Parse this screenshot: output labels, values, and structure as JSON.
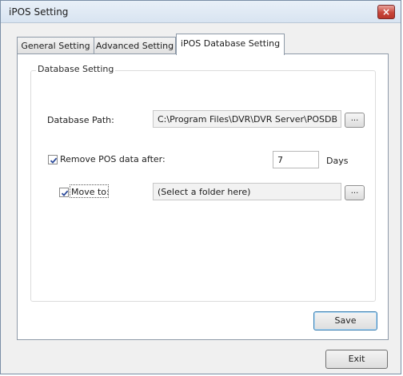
{
  "window": {
    "title": "iPOS Setting",
    "close_symbol": "×"
  },
  "tabs": [
    {
      "label": "General Setting",
      "active": false
    },
    {
      "label": "Advanced Setting",
      "active": false
    },
    {
      "label": "iPOS Database Setting",
      "active": true
    }
  ],
  "database_group": {
    "label": "Database Setting",
    "path_label": "Database Path:",
    "path_value": "C:\\Program Files\\DVR\\DVR Server\\POSDB",
    "browse_label": "...",
    "remove": {
      "label": "Remove POS data after:",
      "checked": true,
      "days_value": "7",
      "days_unit": "Days"
    },
    "move": {
      "label": "Move to:",
      "checked": true,
      "placeholder": "(Select a folder here)",
      "browse_label": "..."
    }
  },
  "buttons": {
    "save_label": "Save",
    "exit_label": "Exit"
  }
}
